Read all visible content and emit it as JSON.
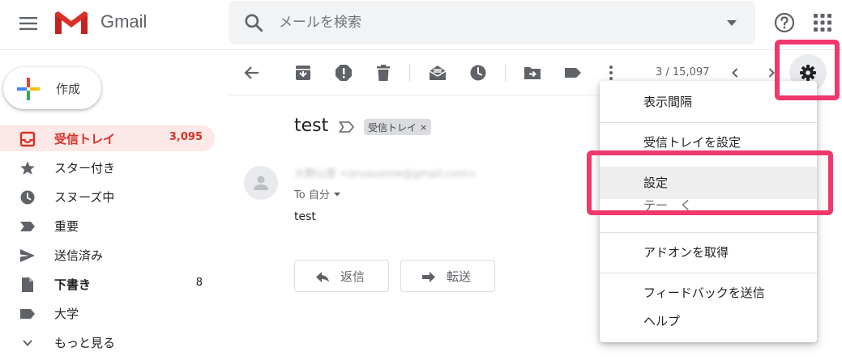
{
  "header": {
    "app_name": "Gmail",
    "search_placeholder": "メールを検索"
  },
  "sidebar": {
    "compose_label": "作成",
    "items": [
      {
        "label": "受信トレイ",
        "count": "3,095",
        "icon": "inbox-icon",
        "active": true
      },
      {
        "label": "スター付き",
        "count": "",
        "icon": "star-icon"
      },
      {
        "label": "スヌーズ中",
        "count": "",
        "icon": "clock-icon"
      },
      {
        "label": "重要",
        "count": "",
        "icon": "label-important-icon"
      },
      {
        "label": "送信済み",
        "count": "",
        "icon": "send-icon"
      },
      {
        "label": "下書き",
        "count": "8",
        "icon": "draft-icon",
        "bold": true
      },
      {
        "label": "大学",
        "count": "",
        "icon": "label-icon"
      },
      {
        "label": "もっと見る",
        "count": "",
        "icon": "chevron-down-icon"
      }
    ]
  },
  "toolbar": {
    "page_count": "3 / 15,097"
  },
  "message": {
    "subject": "test",
    "label_chip": "受信トレイ",
    "label_chip_close": "×",
    "sender": "大野山里 <oruouome@gmail.com>",
    "to_line": "To 自分",
    "body": "test",
    "reply_label": "返信",
    "forward_label": "転送"
  },
  "settings_menu": {
    "items": [
      "表示間隔",
      "受信トレイを設定",
      "設定",
      "テーマ",
      "アドオンを取得",
      "フィードバックを送信",
      "ヘルプ"
    ],
    "partial_item_visible": "テー　く"
  },
  "colors": {
    "accent_red": "#d93025",
    "active_bg": "#fce8e6",
    "highlight_pink": "#f1386d",
    "menu_hover": "#eeeeee"
  }
}
